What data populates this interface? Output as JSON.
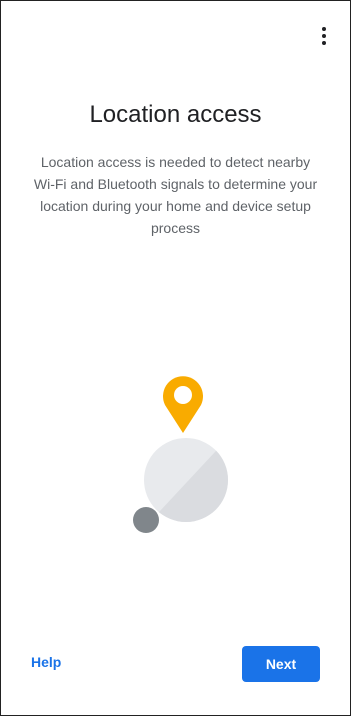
{
  "header": {
    "menu_icon": "more-vert-icon"
  },
  "main": {
    "title": "Location access",
    "description": "Location access is needed to detect nearby Wi-Fi and Bluetooth signals to determine your location during your home and device setup process"
  },
  "illustration": {
    "pin_icon": "location-pin-icon",
    "pin_color": "#F9AB00",
    "globe_color": "#E8EAED",
    "dot_color": "#80868B"
  },
  "footer": {
    "help_label": "Help",
    "next_label": "Next"
  },
  "colors": {
    "accent": "#1A73E8",
    "title_text": "#202124",
    "body_text": "#5F6368"
  }
}
